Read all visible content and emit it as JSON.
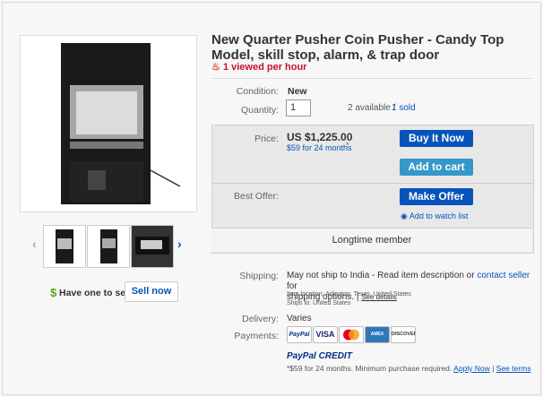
{
  "title": "New Quarter Pusher Coin Pusher - Candy Top Model, skill stop, alarm, & trap door",
  "viewed": "1 viewed per hour",
  "condition": {
    "label": "Condition:",
    "value": "New"
  },
  "quantity": {
    "label": "Quantity:",
    "value": "1",
    "available": "2 available /",
    "sold": "1 sold"
  },
  "price": {
    "label": "Price:",
    "value": "US $1,225.00",
    "monthly": "$59 for 24 months",
    "asterisk": "*"
  },
  "buttons": {
    "buy_now": "Buy It Now",
    "add_to_cart": "Add to cart",
    "make_offer": "Make Offer",
    "watch_list": "Add to watch list"
  },
  "best_offer_label": "Best Offer:",
  "member": "Longtime member",
  "sell": {
    "text": "Have one to sell?",
    "button": "Sell now"
  },
  "shipping": {
    "label": "Shipping:",
    "text1": "May not ship to India - Read item description or",
    "contact": "contact seller",
    "text1_end": "for",
    "text2": "shipping options. |",
    "see_details": "See details",
    "location": "Item location:  Arlington, Texas, United States",
    "ships_to": "Ships to:  United States"
  },
  "delivery": {
    "label": "Delivery:",
    "value": "Varies"
  },
  "payments": {
    "label": "Payments:",
    "cards": [
      "PayPal",
      "VISA",
      "MC",
      "AMEX",
      "DISCOVER"
    ]
  },
  "paypal_credit": {
    "logo": "PayPal CREDIT",
    "text": "*$59 for 24 months. Minimum purchase required.",
    "apply": "Apply Now",
    "sep": "|",
    "terms": "See terms"
  },
  "colors": {
    "accent": "#0654ba",
    "button_light": "#3498ca",
    "alert": "#c41230"
  }
}
